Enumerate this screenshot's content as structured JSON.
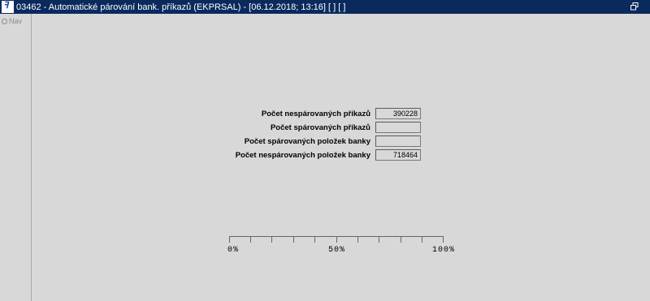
{
  "window": {
    "icon_glyph": "ꟻ",
    "title": "03462 - Automatické párování bank. příkazů (EKPRSAL) - [06.12.2018; 13:16]  [ ]  [ ]",
    "restore_icon": "restore-window-icon",
    "close_glyph": "▫"
  },
  "sidebar": {
    "nav_label": "Nav"
  },
  "form": {
    "rows": [
      {
        "label": "Počet nespárovaných příkazů",
        "value": "390228"
      },
      {
        "label": "Počet spárovaných příkazů",
        "value": ""
      },
      {
        "label": "Počet spárovaných položek banky",
        "value": ""
      },
      {
        "label": "Počet nespárovaných položek banky",
        "value": "718464"
      }
    ]
  },
  "progress": {
    "value_percent": 0,
    "label_start": "0%",
    "label_mid": "50%",
    "label_end": "100%"
  },
  "colors": {
    "titlebar_bg": "#0a2a5e",
    "window_bg": "#d8d8d8"
  }
}
